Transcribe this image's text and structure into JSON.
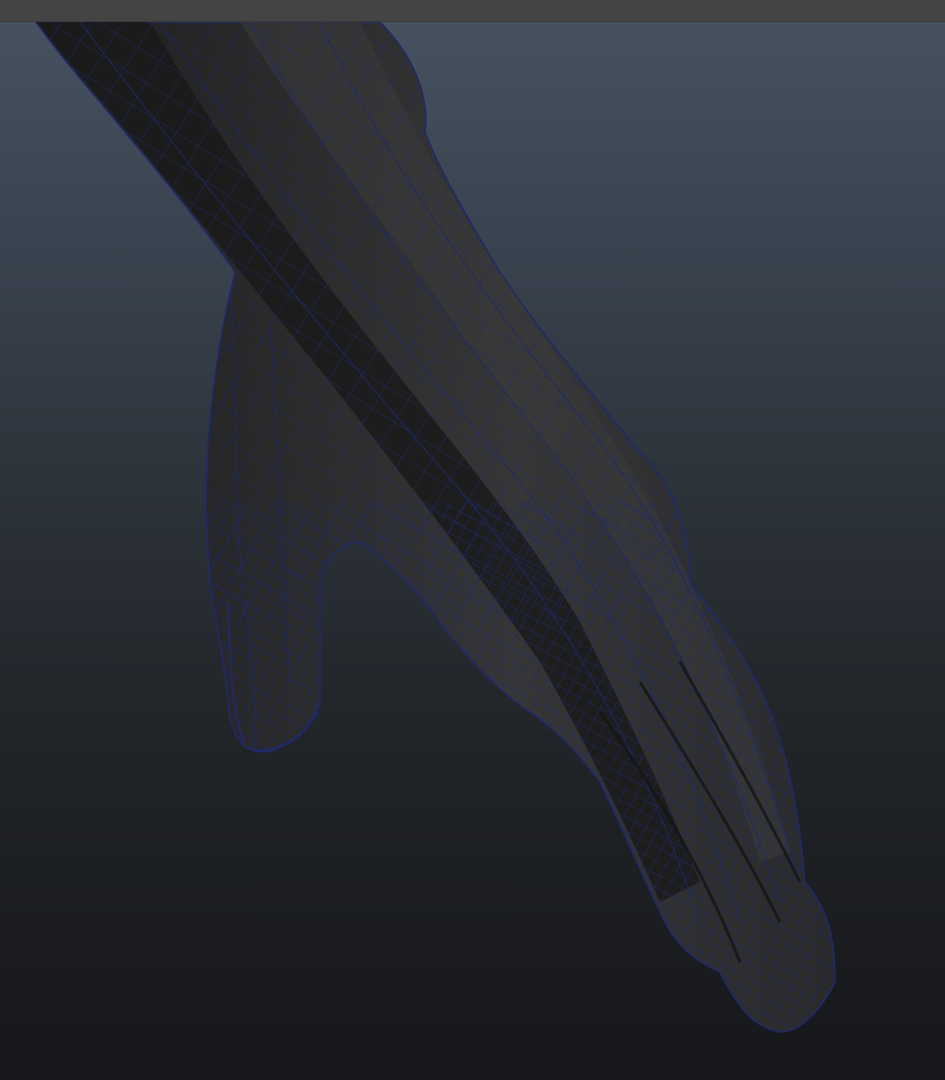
{
  "app": {
    "kind": "3d-modeling-viewport"
  },
  "viewport": {
    "background_top": "#46515f",
    "background_bottom": "#16171a",
    "mesh": {
      "subject": "arm-and-hand-polygon-mesh",
      "display_mode": "smooth-shade-with-wireframe-on-shaded",
      "shade_color": "#303030",
      "shade_dark": "#1c1c1c",
      "shade_light": "#3a3a3a",
      "wire_color": "#1f2a6e"
    }
  },
  "menu_strip": {
    "color": "#444444"
  }
}
